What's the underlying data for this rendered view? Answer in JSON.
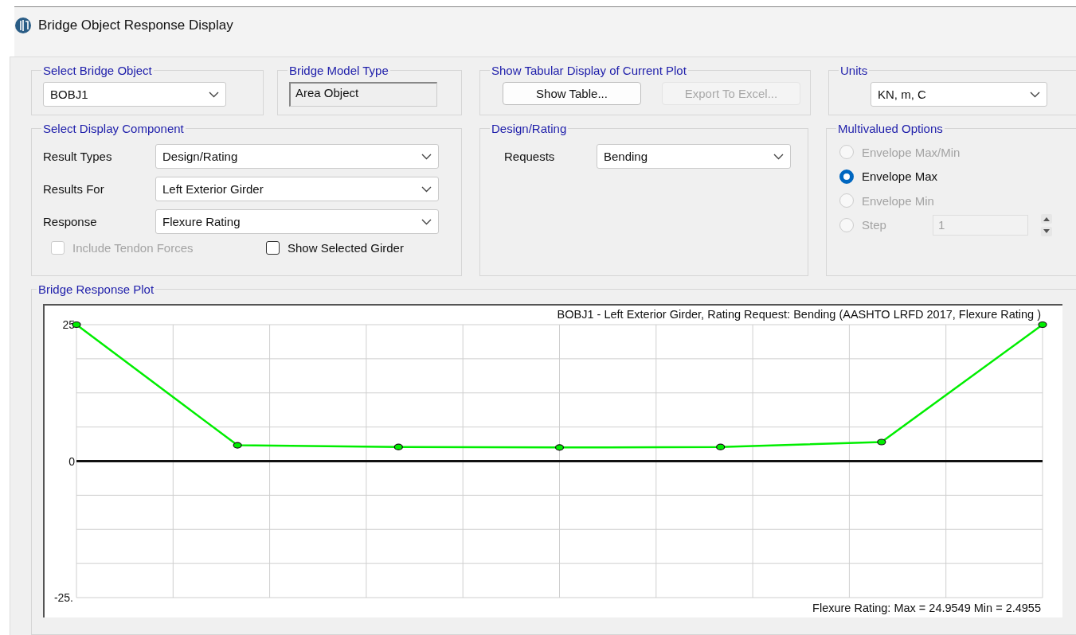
{
  "window": {
    "title": "Bridge Object Response Display"
  },
  "select_bridge_object": {
    "label": "Select Bridge Object",
    "value": "BOBJ1"
  },
  "bridge_model_type": {
    "label": "Bridge Model Type",
    "value": "Area Object"
  },
  "tabular_display": {
    "label": "Show Tabular Display of Current Plot",
    "buttons": [
      {
        "label": "Show Table...",
        "disabled": false
      },
      {
        "label": "Export To Excel...",
        "disabled": true
      }
    ]
  },
  "units": {
    "label": "Units",
    "value": "KN, m, C"
  },
  "display_component": {
    "label": "Select Display Component",
    "fields": [
      {
        "label": "Result Types",
        "value": "Design/Rating"
      },
      {
        "label": "Results For",
        "value": "Left Exterior Girder"
      },
      {
        "label": "Response",
        "value": "Flexure Rating"
      }
    ],
    "checkboxes": [
      {
        "label": "Include Tendon Forces",
        "checked": false,
        "disabled": true
      },
      {
        "label": "Show Selected Girder",
        "checked": false,
        "disabled": false
      }
    ]
  },
  "design_rating": {
    "label": "Design/Rating",
    "fields": [
      {
        "label": "Requests",
        "value": "Bending"
      }
    ]
  },
  "multivalued_options": {
    "label": "Multivalued Options",
    "options": [
      {
        "label": "Envelope Max/Min",
        "selected": false,
        "disabled": true
      },
      {
        "label": "Envelope Max",
        "selected": true,
        "disabled": false
      },
      {
        "label": "Envelope Min",
        "selected": false,
        "disabled": true
      },
      {
        "label": "Step",
        "selected": false,
        "disabled": true
      }
    ],
    "step_value": "1"
  },
  "plot": {
    "label": "Bridge Response Plot",
    "chart_data": {
      "type": "line",
      "title": "BOBJ1 - Left Exterior Girder,  Rating Request: Bending  (AASHTO LRFD 2017, Flexure Rating )",
      "series": [
        {
          "color": "#00ee00",
          "marker": "circle",
          "values": [
            25,
            2.9,
            2.6,
            2.5,
            2.6,
            3.5,
            25
          ]
        }
      ],
      "ylim": [
        -25,
        25
      ],
      "yticks": [
        {
          "value": 25,
          "label": "25"
        },
        {
          "value": 0,
          "label": "0"
        },
        {
          "value": -25,
          "label": "-25."
        }
      ]
    },
    "summary": "Flexure Rating:  Max = 24.9549    Min = 2.4955"
  }
}
